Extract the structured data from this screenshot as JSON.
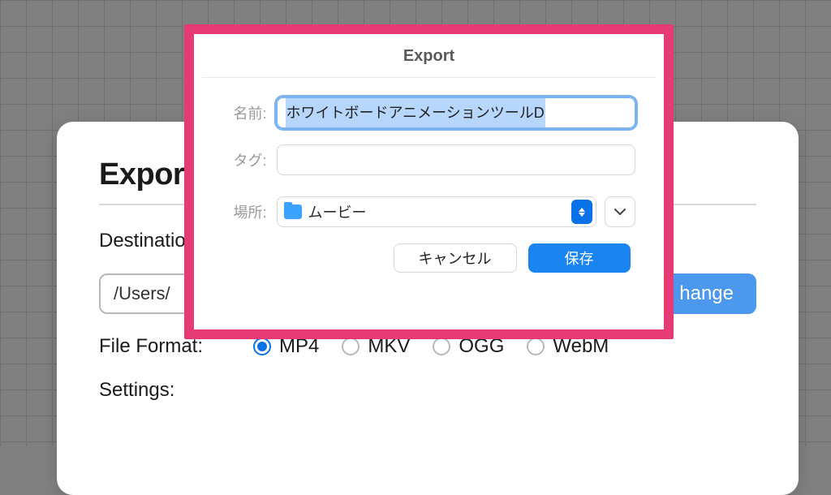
{
  "panel": {
    "title_visible": "Expor",
    "destination_label": "Destinatio",
    "path_visible": "/Users/",
    "change_label": "hange",
    "file_format_label": "File Format:",
    "formats": [
      {
        "label": "MP4",
        "checked": true
      },
      {
        "label": "MKV",
        "checked": false
      },
      {
        "label": "OGG",
        "checked": false
      },
      {
        "label": "WebM",
        "checked": false
      }
    ],
    "settings_label": "Settings:"
  },
  "sheet": {
    "title": "Export",
    "name_label": "名前:",
    "name_value": "ホワイトボードアニメーションツールD",
    "tags_label": "タグ:",
    "tags_value": "",
    "place_label": "場所:",
    "place_value": "ムービー",
    "cancel_label": "キャンセル",
    "save_label": "保存"
  }
}
